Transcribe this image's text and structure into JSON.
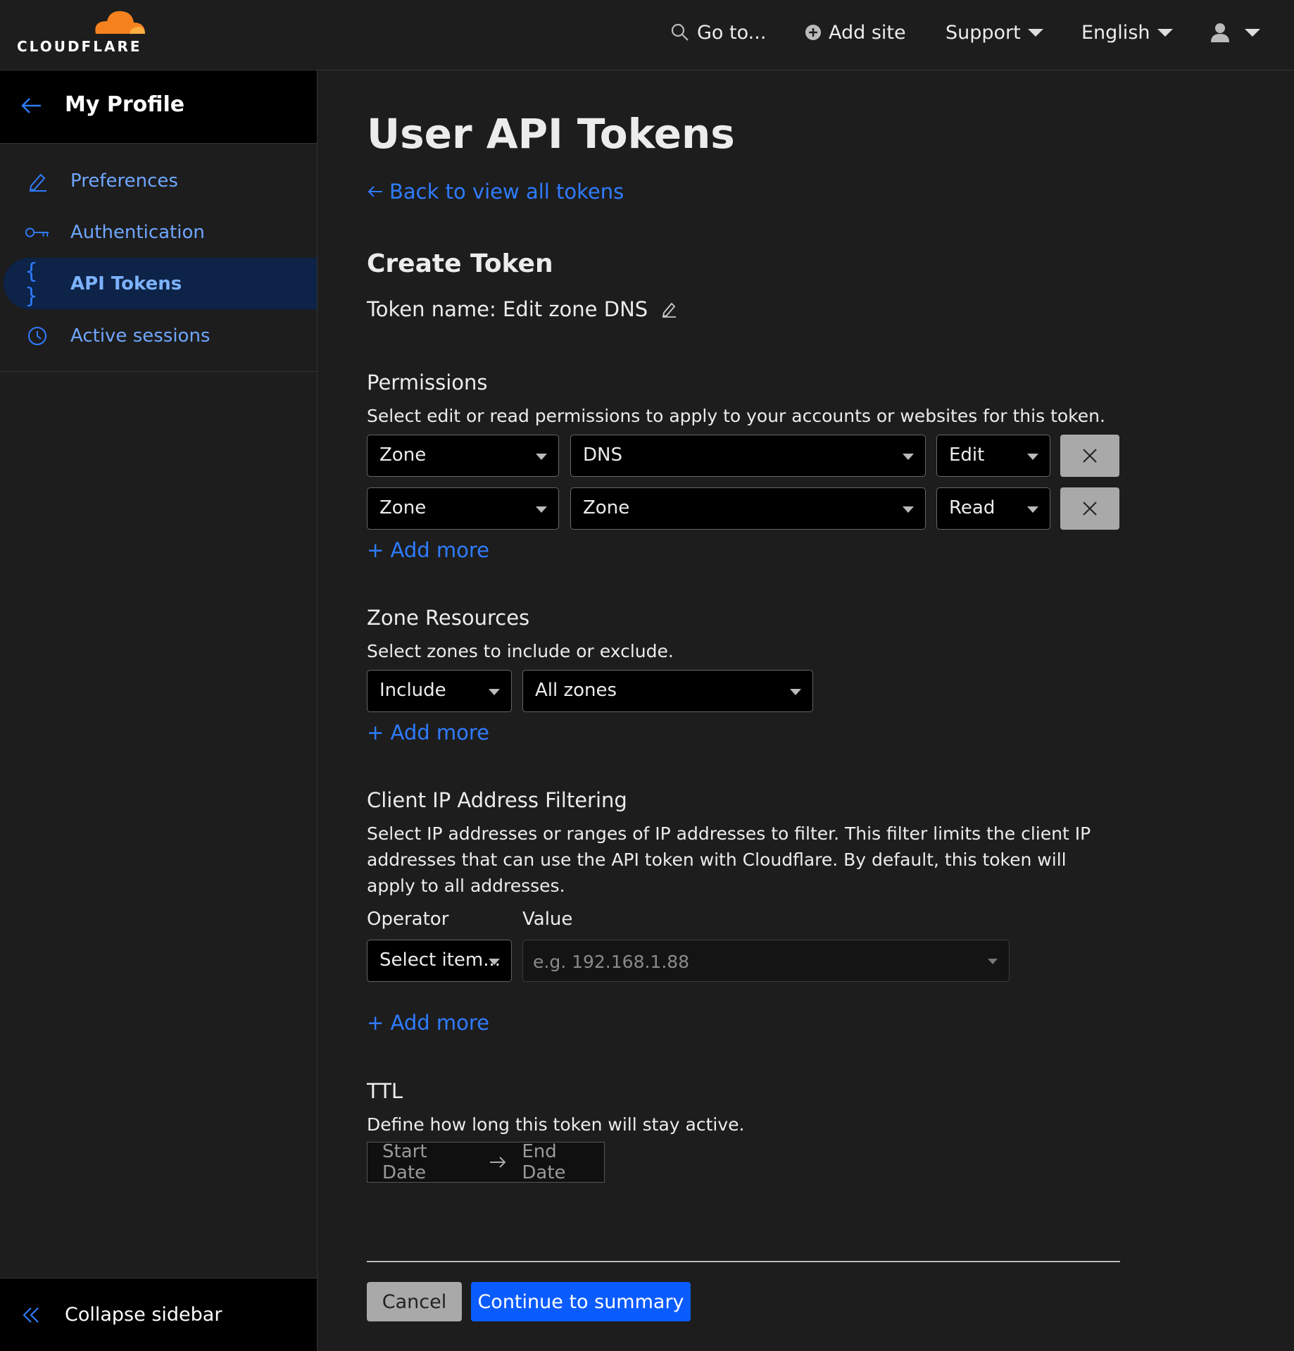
{
  "brand": {
    "name": "CLOUDFLARE",
    "accent": "#f6821f",
    "link_color": "#2f7cff",
    "primary_button": "#0b5cff"
  },
  "topnav": {
    "goto": "Go to...",
    "add_site": "Add site",
    "support": "Support",
    "language": "English",
    "icons": [
      "search-icon",
      "plus-circle-icon",
      "user-icon"
    ]
  },
  "sidebar": {
    "header": "My Profile",
    "items": [
      {
        "label": "Preferences",
        "icon": "pencil-icon"
      },
      {
        "label": "Authentication",
        "icon": "key-icon"
      },
      {
        "label": "API Tokens",
        "icon": "braces-icon",
        "active": true
      },
      {
        "label": "Active sessions",
        "icon": "clock-icon"
      }
    ],
    "collapse": "Collapse sidebar"
  },
  "main": {
    "title": "User API Tokens",
    "back_link": "Back to view all tokens",
    "create_title": "Create Token",
    "token_name": "Token name: Edit zone DNS",
    "permissions": {
      "title": "Permissions",
      "description": "Select edit or read permissions to apply to your accounts or websites for this token.",
      "rows": [
        {
          "scope": "Zone",
          "resource": "DNS",
          "access": "Edit"
        },
        {
          "scope": "Zone",
          "resource": "Zone",
          "access": "Read"
        }
      ],
      "add_more": "+ Add more"
    },
    "zone_resources": {
      "title": "Zone Resources",
      "description": "Select zones to include or exclude.",
      "mode": "Include",
      "zones": "All zones",
      "add_more": "+ Add more"
    },
    "ip_filtering": {
      "title": "Client IP Address Filtering",
      "description": "Select IP addresses or ranges of IP addresses to filter. This filter limits the client IP addresses that can use the API token with Cloudflare. By default, this token will apply to all addresses.",
      "operator_label": "Operator",
      "value_label": "Value",
      "operator_placeholder": "Select item...",
      "value_placeholder": "e.g. 192.168.1.88",
      "add_more": "+ Add more"
    },
    "ttl": {
      "title": "TTL",
      "description": "Define how long this token will stay active.",
      "start": "Start Date",
      "end": "End Date"
    },
    "actions": {
      "cancel": "Cancel",
      "continue": "Continue to summary"
    }
  }
}
